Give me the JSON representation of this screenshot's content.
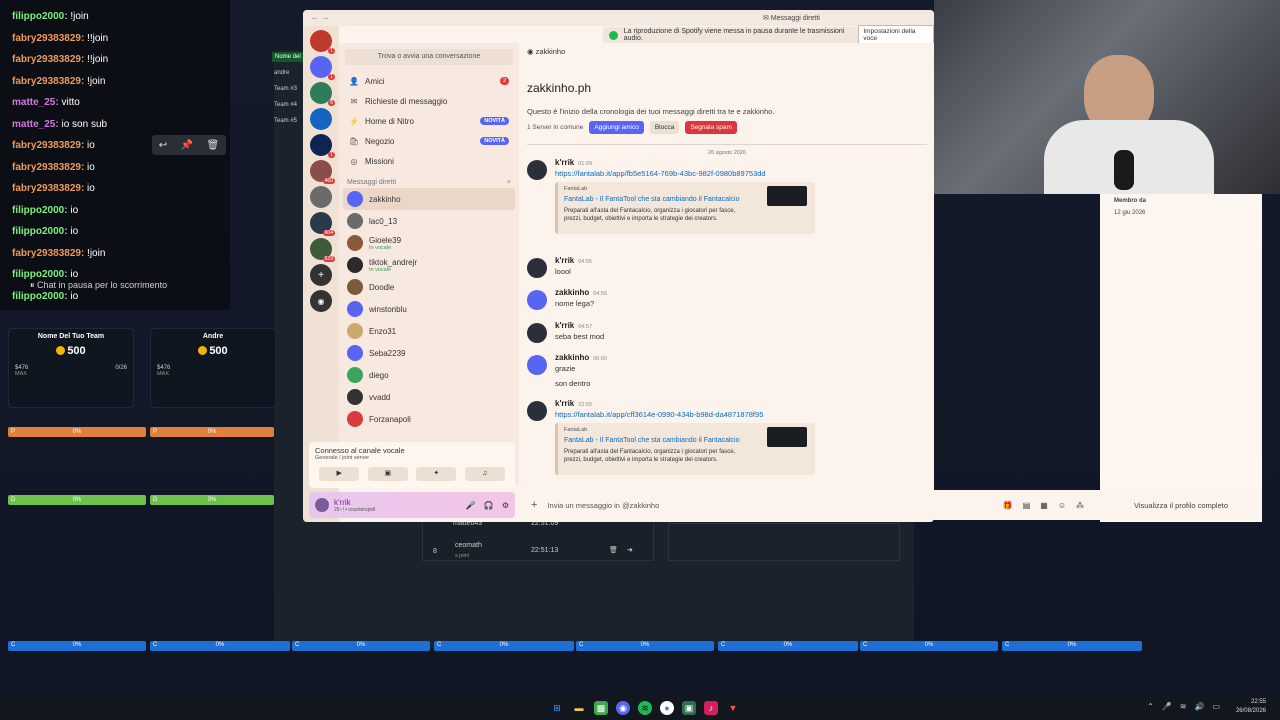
{
  "chat": {
    "lines": [
      {
        "user": "filippo2000:",
        "text": " !join",
        "color": "#7ef07e"
      },
      {
        "user": "fabry29383829:",
        "text": " !!join",
        "color": "#f09a5a"
      },
      {
        "user": "fabry29383829:",
        "text": " !!join",
        "color": "#f09a5a"
      },
      {
        "user": "fabry29383829:",
        "text": " !join",
        "color": "#f09a5a"
      },
      {
        "user": "matte_25:",
        "text": " vitto",
        "color": "#d07adf"
      },
      {
        "user": "matte_25:",
        "text": " io son sub",
        "color": "#d07adf"
      },
      {
        "user": "fabry29383829:",
        "text": " io",
        "color": "#f09a5a"
      },
      {
        "user": "fabry29383829:",
        "text": " io",
        "color": "#f09a5a"
      },
      {
        "user": "fabry29383829:",
        "text": " io",
        "color": "#f09a5a"
      },
      {
        "user": "filippo2000:",
        "text": " io",
        "color": "#7ef07e"
      },
      {
        "user": "filippo2000:",
        "text": " io",
        "color": "#7ef07e"
      },
      {
        "user": "fabry29383829:",
        "text": " !join",
        "color": "#f09a5a"
      },
      {
        "user": "filippo2000:",
        "text": " io",
        "color": "#7ef07e"
      },
      {
        "user": "filippo2000:",
        "text": " io",
        "color": "#7ef07e"
      }
    ],
    "paused": "Chat in pausa per lo scorrimento"
  },
  "teams": [
    {
      "name": "Nome Del Tuo Team",
      "points": "500",
      "stat1": "$476",
      "stat2": "MAX",
      "stat3": "0/26"
    },
    {
      "name": "Andre",
      "points": "500",
      "stat1": "$476",
      "stat2": "MAX",
      "stat3": ""
    }
  ],
  "bg_labels": {
    "t1": "Nome del",
    "t2": "andre",
    "t3": "Team #3",
    "t4": "Team #4",
    "t5": "Team #5"
  },
  "bg_table": {
    "row1_name": "matteo43",
    "row1_time": "22:51:09",
    "row2_num": "8",
    "row2_name": "ceomath",
    "row2_sub": "s join!",
    "row2_time": "22:51:13"
  },
  "discord": {
    "window_title": "Messaggi diretti",
    "notice": "La riproduzione di Spotify viene messa in pausa durante le trasmissioni audio.",
    "notice_btn": "Impostazioni della voce",
    "search": "Trova o avvia una conversazione",
    "nav": [
      {
        "label": "Amici",
        "icon": "👤",
        "badge": "2"
      },
      {
        "label": "Richieste di messaggio",
        "icon": "✉",
        "badge": ""
      },
      {
        "label": "Home di Nitro",
        "icon": "⚡",
        "new": "NOVITÀ"
      },
      {
        "label": "Negozio",
        "icon": "🛍",
        "new": "NOVITÀ"
      },
      {
        "label": "Missioni",
        "icon": "◎",
        "new": ""
      }
    ],
    "dm_header": "Messaggi diretti",
    "dms": [
      {
        "name": "zakkinho",
        "sub": "",
        "color": "#5865f2"
      },
      {
        "name": "lac0_13",
        "sub": "",
        "color": "#6b6b6b"
      },
      {
        "name": "Gioele39",
        "sub": "In vocale",
        "color": "#8b5a3c"
      },
      {
        "name": "tiktok_andrejr",
        "sub": "In vocale",
        "color": "#2b2b2b"
      },
      {
        "name": "Doodle",
        "sub": "",
        "color": "#7a5a3a"
      },
      {
        "name": "winstonblu",
        "sub": "",
        "color": "#5865f2"
      },
      {
        "name": "Enzo31",
        "sub": "",
        "color": "#c9a96e"
      },
      {
        "name": "Seba2239",
        "sub": "",
        "color": "#5865f2"
      },
      {
        "name": "diego",
        "sub": "",
        "color": "#3ba55d"
      },
      {
        "name": "vvadd",
        "sub": "",
        "color": "#333"
      },
      {
        "name": "Forzanapoli",
        "sub": "",
        "color": "#d83c3e"
      }
    ],
    "voice": {
      "title": "Connesso al canale vocale",
      "sub": "Generale / joint server"
    },
    "user": {
      "name": "k'rrik",
      "sub": "25~! • counterspell"
    },
    "channel": "zakkinho",
    "intro_name": "zakkinho.ph",
    "intro_desc": "Questo è l'inizio della cronologia dei tuoi messaggi diretti tra te e zakkinho.",
    "common": "1 Server in comune",
    "btn_add": "Aggiungi amico",
    "btn_block": "Blocca",
    "btn_spam": "Segnala spam",
    "date": "26 agosto 2026",
    "messages": [
      {
        "author": "k'rrik",
        "time": "01:09",
        "body": "https://fantalab.it/app/fb5e5164-769b-43bc-982f-0980b89753dd",
        "link": true,
        "embed": {
          "prov": "FantaLab",
          "title": "FantaLab - Il FantaTool che sta cambiando il Fantacalcio",
          "desc": "Preparati all'asta del Fantacalcio, organizza i giocatori per fasce, prezzi, budget, obiettivi e importa le strategie dei creators."
        }
      },
      {
        "author": "k'rrik",
        "time": "04:55",
        "body": "loool"
      },
      {
        "author": "zakkinho",
        "time": "04:56",
        "body": "nome lega?"
      },
      {
        "author": "k'rrik",
        "time": "04:57",
        "body": "seba best mod"
      },
      {
        "author": "zakkinho",
        "time": "06:00",
        "body": "grazie",
        "body2": "son dentro"
      },
      {
        "author": "k'rrik",
        "time": "22:55",
        "body": "https://fantalab.it/app/cff3614e-0990-434b-b98d-da4871878f95",
        "link": true,
        "embed": {
          "prov": "FantaLab",
          "title": "FantaLab - Il FantaTool che sta cambiando il Fantacalcio",
          "desc": "Preparati all'asta del Fantacalcio, organizza i giocatori per fasce, prezzi, budget, obiettivi e importa le strategie dei creators."
        }
      }
    ],
    "composer_placeholder": "Invia un messaggio in @zakkinho",
    "profile_btn": "Visualizza il profilo completo",
    "member_label": "Membro da",
    "member_date": "12 giu 2026"
  },
  "bars": {
    "orange_left": "0%",
    "orange_right": "0%",
    "green_left": "0%",
    "green_right": "0%",
    "p": "P",
    "d": "D",
    "c": "C"
  },
  "bottom_bars": [
    "0%",
    "0%",
    "0%",
    "0%",
    "0%",
    "0%",
    "0%",
    "0%"
  ],
  "tray": {
    "time": "22:55",
    "date": "26/08/2026"
  }
}
